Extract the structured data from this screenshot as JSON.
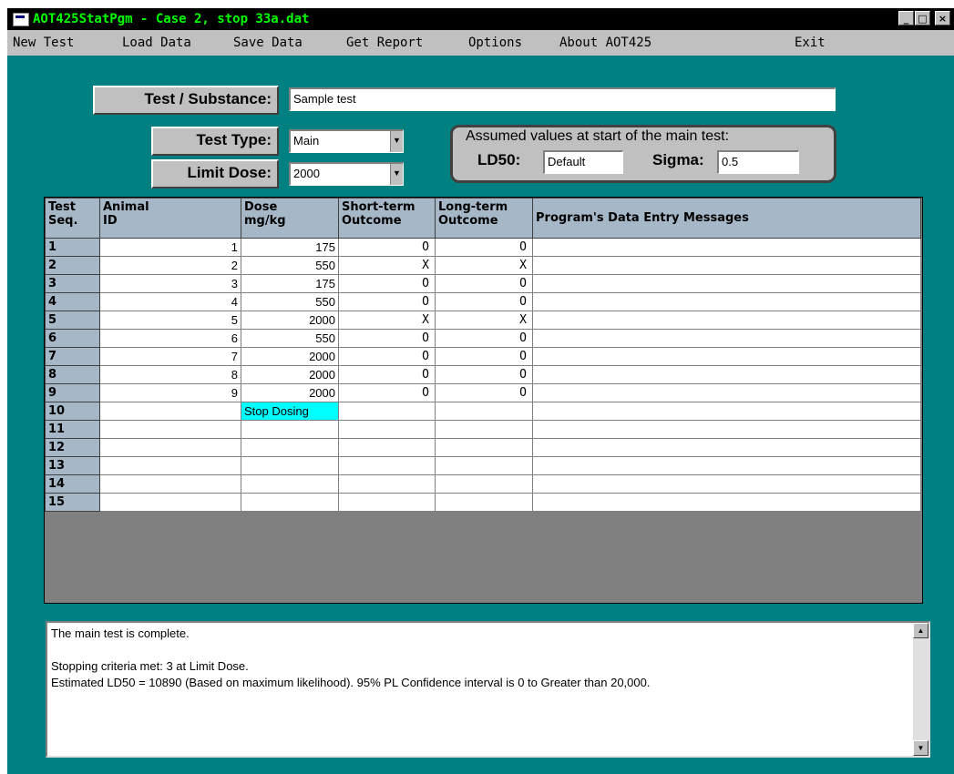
{
  "window": {
    "title": "AOT425StatPgm - Case 2, stop 33a.dat",
    "controls": [
      "_",
      "□",
      "×"
    ]
  },
  "menu": {
    "new_test": "New Test",
    "load_data": "Load Data",
    "save_data": "Save Data",
    "get_report": "Get Report",
    "options": "Options",
    "about": "About AOT425",
    "exit": "Exit"
  },
  "form": {
    "substance_label": "Test / Substance:",
    "substance_value": "Sample test",
    "test_type_label": "Test Type:",
    "test_type_value": "Main",
    "limit_dose_label": "Limit Dose:",
    "limit_dose_value": "2000"
  },
  "assumed": {
    "caption": "Assumed values at start of the main test:",
    "ld50_label": "LD50:",
    "ld50_value": "Default",
    "sigma_label": "Sigma:",
    "sigma_value": "0.5"
  },
  "table": {
    "headers": {
      "seq": [
        "Test",
        "Seq."
      ],
      "animal": [
        "Animal",
        "ID"
      ],
      "dose": [
        "Dose",
        "mg/kg"
      ],
      "short": [
        "Short-term",
        "Outcome"
      ],
      "long": [
        "Long-term",
        "Outcome"
      ],
      "messages": [
        "Program's Data Entry Messages",
        ""
      ]
    },
    "rows": [
      {
        "seq": "1",
        "animal": "1",
        "dose": "175",
        "short": "O",
        "long": "O",
        "msg": ""
      },
      {
        "seq": "2",
        "animal": "2",
        "dose": "550",
        "short": "X",
        "long": "X",
        "msg": ""
      },
      {
        "seq": "3",
        "animal": "3",
        "dose": "175",
        "short": "O",
        "long": "O",
        "msg": ""
      },
      {
        "seq": "4",
        "animal": "4",
        "dose": "550",
        "short": "O",
        "long": "O",
        "msg": ""
      },
      {
        "seq": "5",
        "animal": "5",
        "dose": "2000",
        "short": "X",
        "long": "X",
        "msg": ""
      },
      {
        "seq": "6",
        "animal": "6",
        "dose": "550",
        "short": "O",
        "long": "O",
        "msg": ""
      },
      {
        "seq": "7",
        "animal": "7",
        "dose": "2000",
        "short": "O",
        "long": "O",
        "msg": ""
      },
      {
        "seq": "8",
        "animal": "8",
        "dose": "2000",
        "short": "O",
        "long": "O",
        "msg": ""
      },
      {
        "seq": "9",
        "animal": "9",
        "dose": "2000",
        "short": "O",
        "long": "O",
        "msg": ""
      },
      {
        "seq": "10",
        "animal": "",
        "dose": "Stop Dosing",
        "short": "",
        "long": "",
        "msg": ""
      },
      {
        "seq": "11",
        "animal": "",
        "dose": "",
        "short": "",
        "long": "",
        "msg": ""
      },
      {
        "seq": "12",
        "animal": "",
        "dose": "",
        "short": "",
        "long": "",
        "msg": ""
      },
      {
        "seq": "13",
        "animal": "",
        "dose": "",
        "short": "",
        "long": "",
        "msg": ""
      },
      {
        "seq": "14",
        "animal": "",
        "dose": "",
        "short": "",
        "long": "",
        "msg": ""
      },
      {
        "seq": "15",
        "animal": "",
        "dose": "",
        "short": "",
        "long": "",
        "msg": ""
      }
    ]
  },
  "messages": {
    "line1": "The main test is complete.",
    "line2": "Stopping criteria met: 3 at Limit Dose.",
    "line3": "Estimated LD50 = 10890 (Based on maximum likelihood). 95% PL Confidence interval is 0 to Greater than 20,000."
  },
  "colors": {
    "background": "#008080",
    "header_cell": "#a6b8c8",
    "stop_highlight": "#00ffff",
    "title_text": "#00ff00"
  }
}
